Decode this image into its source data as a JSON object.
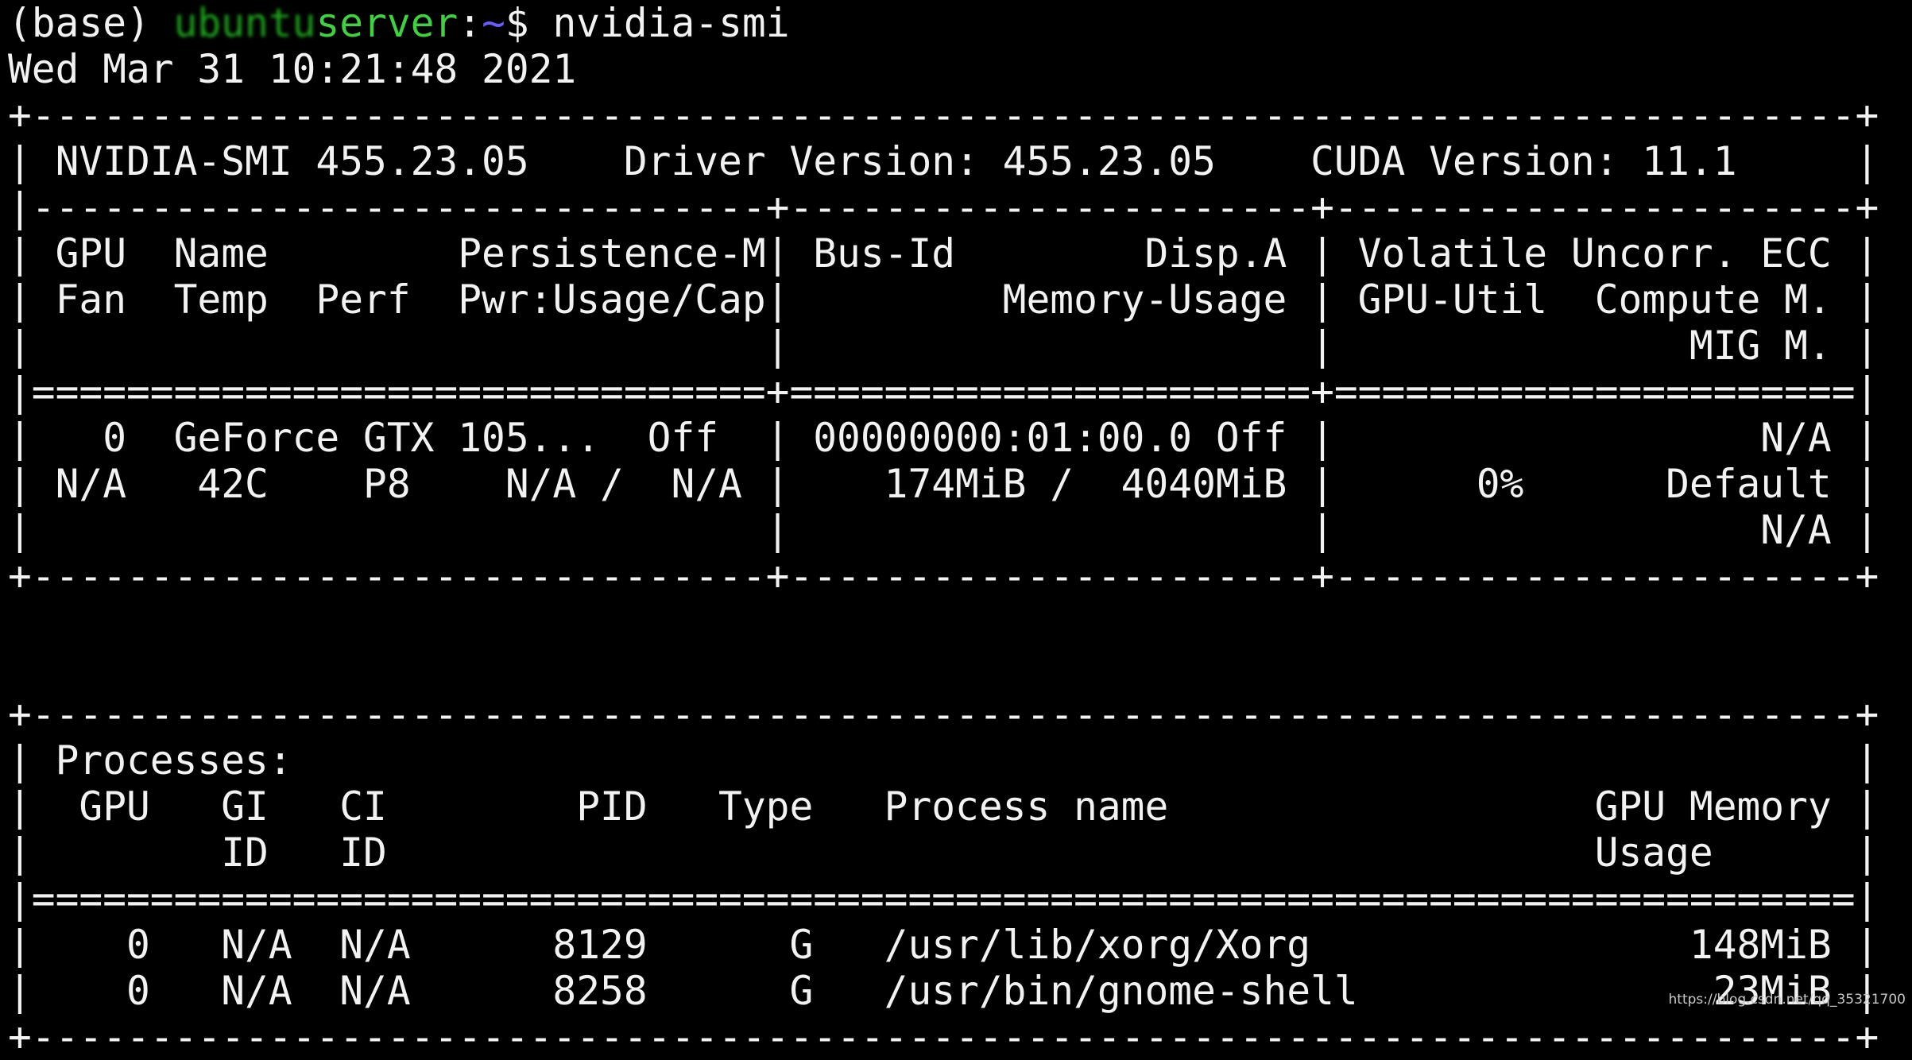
{
  "prompt": {
    "env": "(base)",
    "user_host": "ubuntu",
    "host_suffix": "server",
    "colon": ":",
    "path": "~",
    "symbol": "$",
    "command": "nvidia-smi"
  },
  "timestamp": "Wed Mar 31 10:21:48 2021",
  "smi": {
    "border_top": "+-----------------------------------------------------------------------------+",
    "version_line": "| NVIDIA-SMI 455.23.05    Driver Version: 455.23.05    CUDA Version: 11.1     |",
    "gpu_sep": "|-------------------------------+----------------------+----------------------+",
    "gpu_header": [
      "| GPU  Name        Persistence-M| Bus-Id        Disp.A | Volatile Uncorr. ECC |",
      "| Fan  Temp  Perf  Pwr:Usage/Cap|         Memory-Usage | GPU-Util  Compute M. |",
      "|                               |                      |               MIG M. |"
    ],
    "gpu_eq": "|===============================+======================+======================|",
    "gpu_rows": [
      "|   0  GeForce GTX 105...  Off  | 00000000:01:00.0 Off |                  N/A |",
      "| N/A   42C    P8    N/A /  N/A |    174MiB /  4040MiB |      0%      Default |",
      "|                               |                      |                  N/A |"
    ],
    "gpu_bottom": "+-------------------------------+----------------------+----------------------+",
    "blank": " ",
    "proc_top": "+-----------------------------------------------------------------------------+",
    "proc_header": [
      "| Processes:                                                                  |",
      "|  GPU   GI   CI        PID   Type   Process name                  GPU Memory |",
      "|        ID   ID                                                   Usage      |"
    ],
    "proc_eq": "|=============================================================================|",
    "proc_rows": [
      "|    0   N/A  N/A      8129      G   /usr/lib/xorg/Xorg                148MiB |",
      "|    0   N/A  N/A      8258      G   /usr/bin/gnome-shell               23MiB |"
    ],
    "proc_bottom": "+-----------------------------------------------------------------------------+"
  },
  "watermark": "https://blog.csdn.net/qq_35321700",
  "colors": {
    "background": "#000000",
    "foreground": "#f2f2f2",
    "prompt_green": "#3fd13f",
    "path_blue": "#6b5cff"
  }
}
